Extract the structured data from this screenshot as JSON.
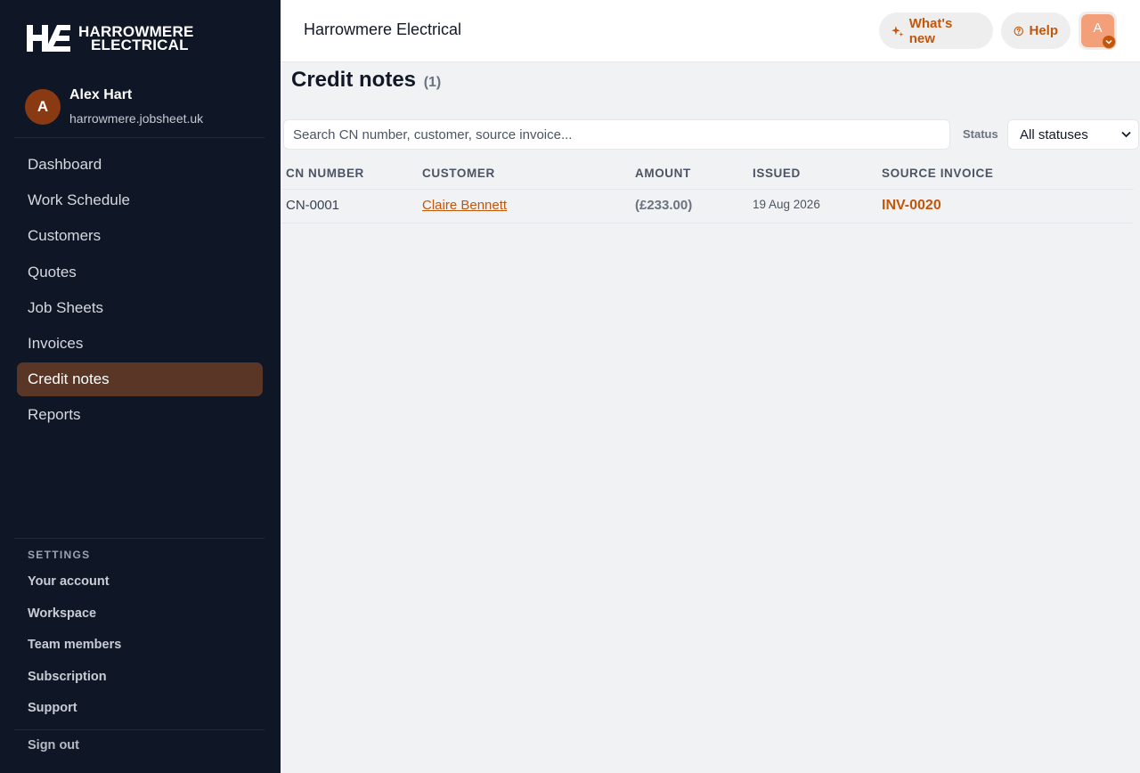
{
  "brand": {
    "line1": "HARROWMERE",
    "line2": "ELECTRICAL"
  },
  "user": {
    "initial": "A",
    "name": "Alex Hart",
    "domain": "harrowmere.jobsheet.uk"
  },
  "nav": [
    {
      "label": "Dashboard",
      "active": false
    },
    {
      "label": "Work Schedule",
      "active": false
    },
    {
      "label": "Customers",
      "active": false
    },
    {
      "label": "Quotes",
      "active": false
    },
    {
      "label": "Job Sheets",
      "active": false
    },
    {
      "label": "Invoices",
      "active": false
    },
    {
      "label": "Credit notes",
      "active": true
    },
    {
      "label": "Reports",
      "active": false
    }
  ],
  "settings": {
    "title": "SETTINGS",
    "items": [
      "Your account",
      "Workspace",
      "Team members",
      "Subscription",
      "Support"
    ],
    "signout": "Sign out"
  },
  "topbar": {
    "org_name": "Harrowmere Electrical",
    "whats_new": "What's new",
    "help": "Help",
    "avatar_initial": "A"
  },
  "page": {
    "title": "Credit notes",
    "count": "(1)"
  },
  "filters": {
    "search_placeholder": "Search CN number, customer, source invoice...",
    "status_label": "Status",
    "status_value": "All statuses"
  },
  "table": {
    "headers": [
      "CN NUMBER",
      "CUSTOMER",
      "AMOUNT",
      "ISSUED",
      "SOURCE INVOICE"
    ],
    "rows": [
      {
        "cn": "CN-0001",
        "customer": "Claire Bennett",
        "amount": "(£233.00)",
        "issued": "19 Aug 2026",
        "source": "INV-0020"
      }
    ]
  },
  "colors": {
    "sidebar": "#0f1625",
    "accent": "#c2570c",
    "active_nav": "#5a3626"
  }
}
